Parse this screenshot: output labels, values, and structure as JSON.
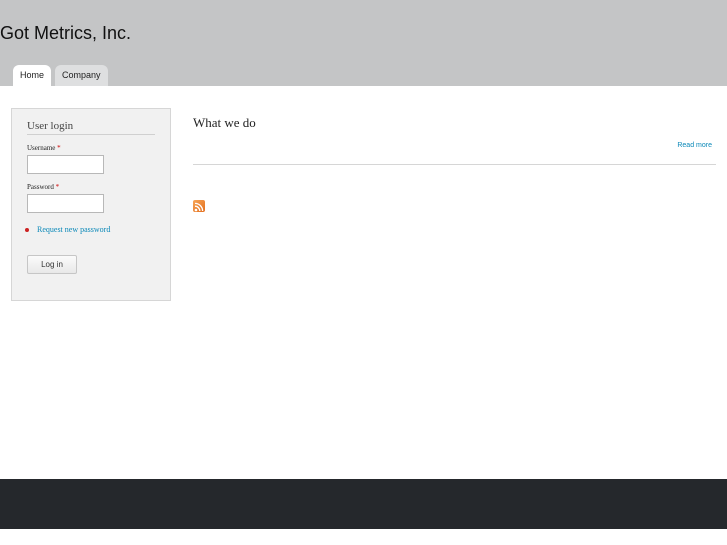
{
  "header": {
    "site_name": "Got Metrics, Inc.",
    "tabs": [
      {
        "label": "Home",
        "active": true
      },
      {
        "label": "Company",
        "active": false
      }
    ],
    "background_color": "#c4c5c6"
  },
  "sidebar": {
    "block_title": "User login",
    "username_label": "Username",
    "password_label": "Password",
    "required_marker": "*",
    "username_value": "",
    "password_value": "",
    "links": [
      {
        "label": "Request new password"
      }
    ],
    "login_button_label": "Log in"
  },
  "main": {
    "title": "What we do",
    "read_more_label": "Read more",
    "feed_icon": "rss-feed-icon"
  },
  "colors": {
    "link": "#0a88b8",
    "footer": "#25282c",
    "required": "#cc0000"
  }
}
